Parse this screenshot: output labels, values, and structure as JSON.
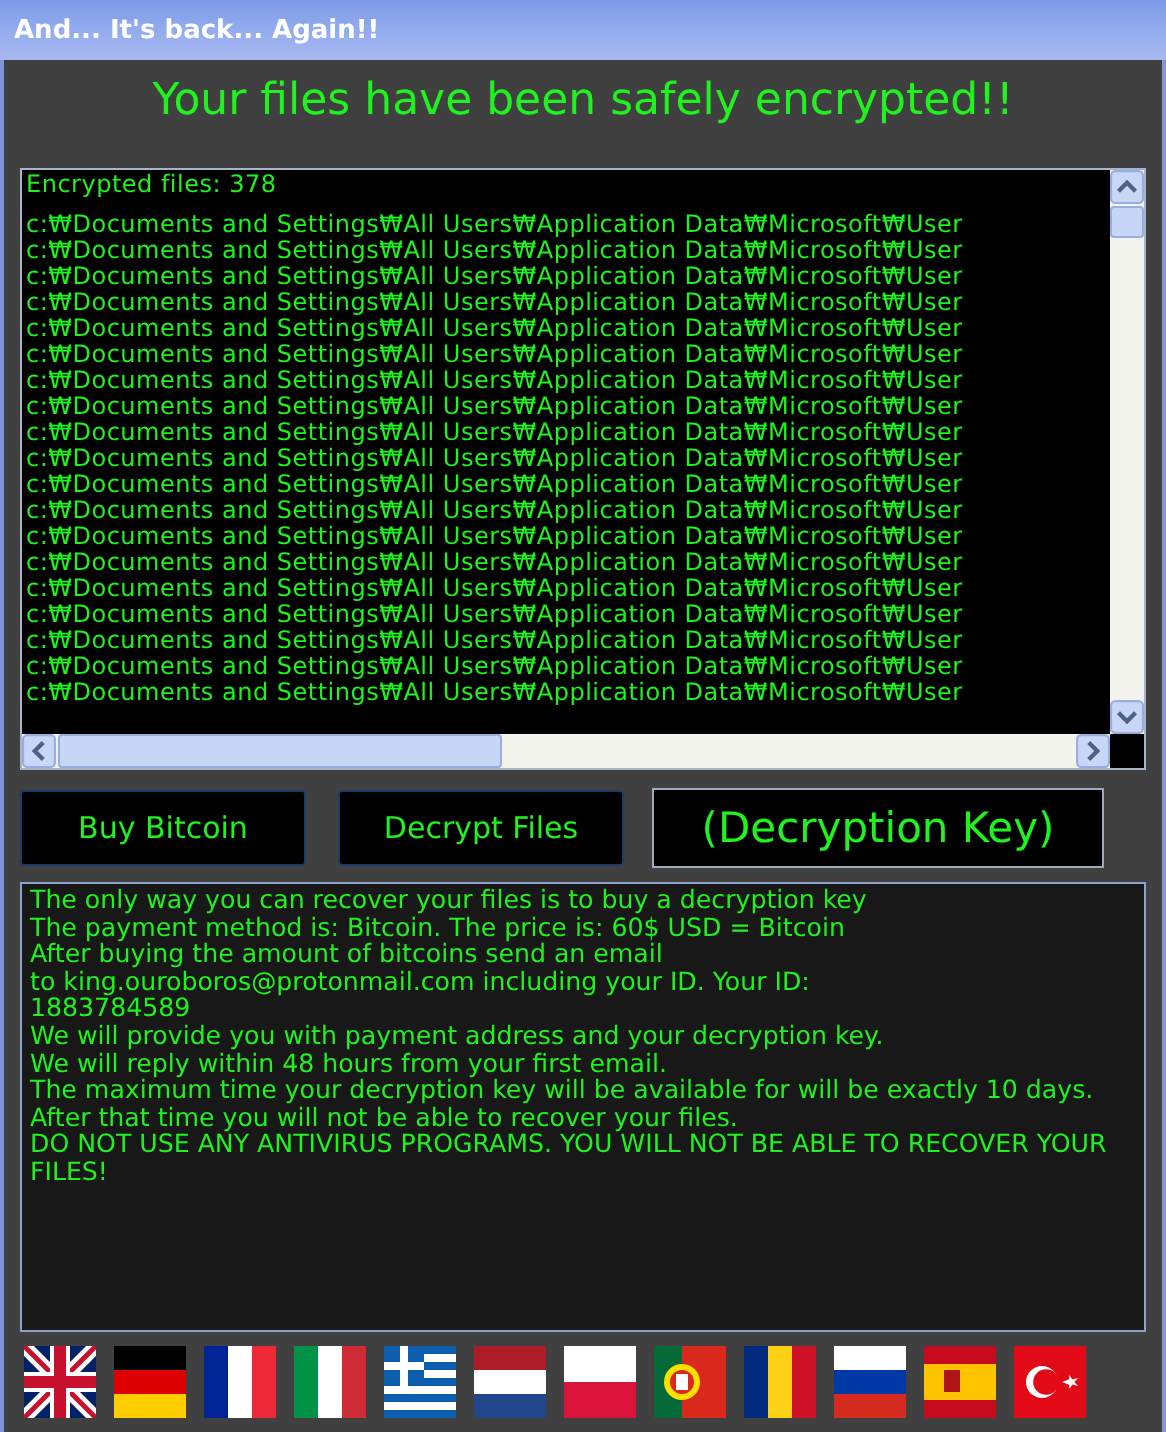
{
  "window": {
    "title": "And... It's back... Again!!"
  },
  "headline": "Your files have been safely encrypted!!",
  "log": {
    "count_line": "Encrypted files: 378",
    "lines": [
      "c:₩Documents and Settings₩All Users₩Application Data₩Microsoft₩User",
      "c:₩Documents and Settings₩All Users₩Application Data₩Microsoft₩User",
      "c:₩Documents and Settings₩All Users₩Application Data₩Microsoft₩User",
      "c:₩Documents and Settings₩All Users₩Application Data₩Microsoft₩User",
      "c:₩Documents and Settings₩All Users₩Application Data₩Microsoft₩User",
      "c:₩Documents and Settings₩All Users₩Application Data₩Microsoft₩User",
      "c:₩Documents and Settings₩All Users₩Application Data₩Microsoft₩User",
      "c:₩Documents and Settings₩All Users₩Application Data₩Microsoft₩User",
      "c:₩Documents and Settings₩All Users₩Application Data₩Microsoft₩User",
      "c:₩Documents and Settings₩All Users₩Application Data₩Microsoft₩User",
      "c:₩Documents and Settings₩All Users₩Application Data₩Microsoft₩User",
      "c:₩Documents and Settings₩All Users₩Application Data₩Microsoft₩User",
      "c:₩Documents and Settings₩All Users₩Application Data₩Microsoft₩User",
      "c:₩Documents and Settings₩All Users₩Application Data₩Microsoft₩User",
      "c:₩Documents and Settings₩All Users₩Application Data₩Microsoft₩User",
      "c:₩Documents and Settings₩All Users₩Application Data₩Microsoft₩User",
      "c:₩Documents and Settings₩All Users₩Application Data₩Microsoft₩User",
      "c:₩Documents and Settings₩All Users₩Application Data₩Microsoft₩User",
      "c:₩Documents and Settings₩All Users₩Application Data₩Microsoft₩User"
    ]
  },
  "buttons": [
    "Buy Bitcoin",
    "Decrypt Files"
  ],
  "key_field": {
    "value": "(Decryption Key)"
  },
  "message": [
    "The only way you can recover your files is to buy a decryption key",
    "The payment method is: Bitcoin. The price is: 60$ USD =  Bitcoin",
    "After buying the amount of bitcoins send an email",
    "to king.ouroboros@protonmail.com including your ID. Your ID:",
    "1883784589",
    "We will provide you with payment address and your decryption key.",
    "We will reply within 48 hours from your first email.",
    "The maximum time your decryption key will be available for will be exactly 10 days. After that time you will not be able to recover your files.",
    "DO NOT USE ANY ANTIVIRUS PROGRAMS. YOU WILL NOT BE ABLE TO RECOVER YOUR FILES!"
  ]
}
